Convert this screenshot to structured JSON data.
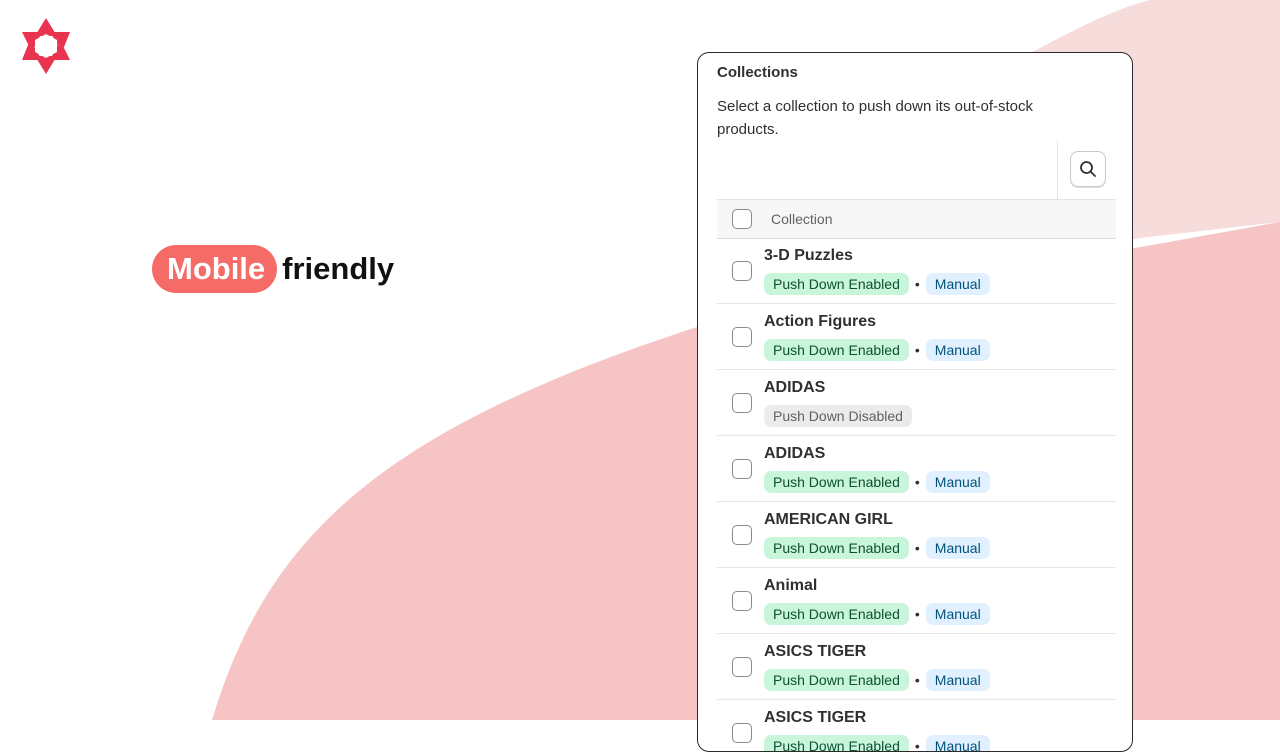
{
  "hero": {
    "highlight": "Mobile",
    "rest": "friendly"
  },
  "card": {
    "title": "Collections",
    "description": "Select a collection to push down its out-of-stock products.",
    "column_header": "Collection"
  },
  "collections": [
    {
      "name": "3-D Puzzles",
      "status": "Push Down Enabled",
      "mode": "Manual",
      "separator": "•"
    },
    {
      "name": "Action Figures",
      "status": "Push Down Enabled",
      "mode": "Manual",
      "separator": "•"
    },
    {
      "name": "ADIDAS",
      "status": "Push Down Disabled"
    },
    {
      "name": "ADIDAS",
      "status": "Push Down Enabled",
      "mode": "Manual",
      "separator": "•"
    },
    {
      "name": "AMERICAN GIRL",
      "status": "Push Down Enabled",
      "mode": "Manual",
      "separator": "•"
    },
    {
      "name": "Animal",
      "status": "Push Down Enabled",
      "mode": "Manual",
      "separator": "•"
    },
    {
      "name": "ASICS TIGER",
      "status": "Push Down Enabled",
      "mode": "Manual",
      "separator": "•"
    },
    {
      "name": "ASICS TIGER",
      "status": "Push Down Enabled",
      "mode": "Manual",
      "separator": "•"
    }
  ],
  "colors": {
    "brand": "#e8344e",
    "accent_pill": "#f56b68",
    "blob_light": "#f7dcdc",
    "blob": "#f6c4c4"
  },
  "icons": {
    "logo": "brand-star-logo-icon",
    "search": "search-icon"
  }
}
